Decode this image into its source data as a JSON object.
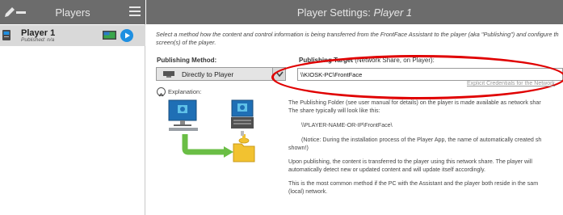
{
  "left_panel": {
    "title": "Players",
    "icons": {
      "edit": "pencil-icon",
      "remove": "minus-icon",
      "menu": "hamburger-menu-icon"
    },
    "players": [
      {
        "name": "Player 1",
        "status": "Published: n/a",
        "icons": [
          "pc-icon",
          "monitor-icon",
          "play-icon"
        ]
      }
    ]
  },
  "right_panel": {
    "title_prefix": "Player Settings: ",
    "title_player": "Player 1",
    "description": "Select a method how the content and control information is being transferred from the FrontFace Assistant to the player (aka \"Publishing\") and configure th",
    "description_line2": "screen(s) of the player.",
    "publishing_method": {
      "label": "Publishing Method:",
      "selected": "Directly to Player"
    },
    "explanation_label": "Explanation:",
    "publishing_target": {
      "label": "Publishing Target",
      "hint": "(Network Share, on Player):",
      "value": "\\\\KIOSK-PC\\FrontFace"
    },
    "explicit_link": "Explicit Credentials for the Network",
    "explanation_lines": [
      "The Publishing Folder (see user manual for details) on the player is made available as network shar",
      "The share typically will look like this:",
      "\\\\PLAYER-NAME-OR-IP\\FrontFace\\",
      "(Notice: During the installation process of the Player App, the name of automatically created sh",
      "shown!)",
      "Upon publishing, the content is transferred to the player using this network share. The player will",
      "automatically detect new or updated content and will update itself accordingly.",
      "This is the most common method if the PC with the Assistant and the player both reside in the sam",
      "(local) network."
    ]
  },
  "colors": {
    "header_bg": "#6c6c6c",
    "header_text": "#e6e6e6",
    "selected_row": "#d9d9d9",
    "play_blue": "#1e8fe1",
    "annotation_red": "#e00000",
    "arrow_green": "#6abe45",
    "folder_yellow": "#f2c230"
  }
}
